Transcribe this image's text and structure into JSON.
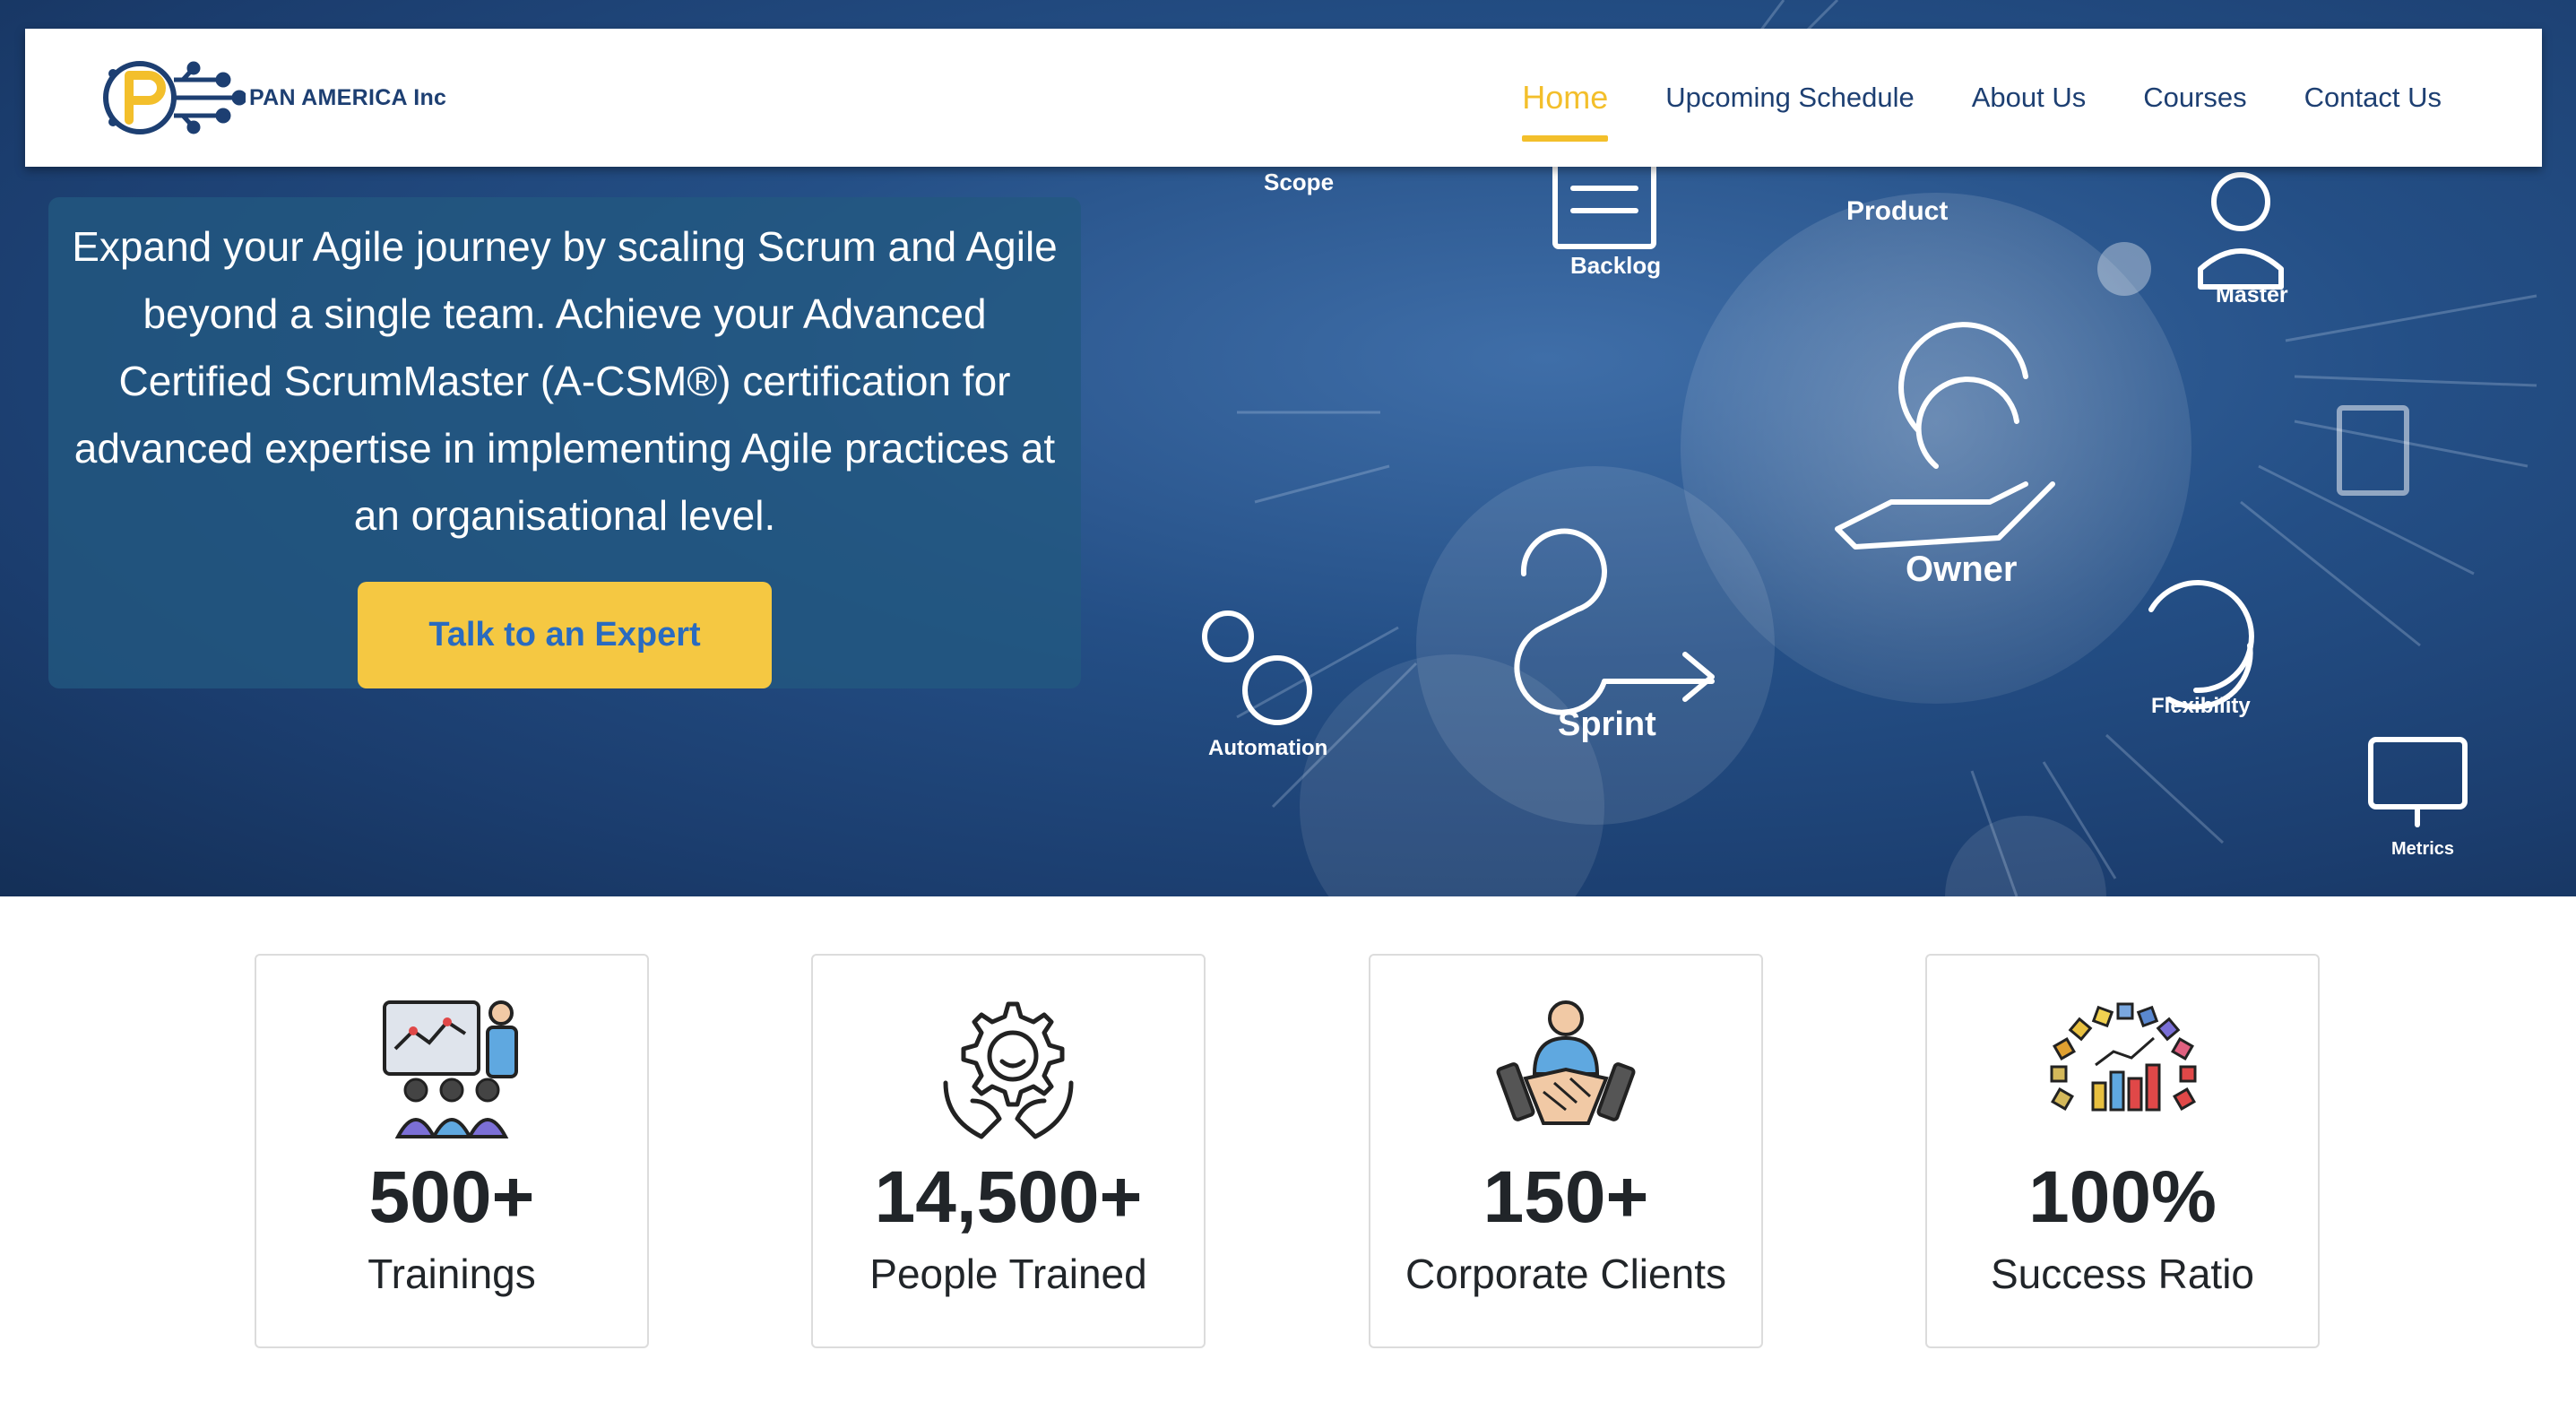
{
  "brand": {
    "name": "PAN AMERICA Inc"
  },
  "nav": {
    "items": [
      {
        "label": "Home",
        "active": true
      },
      {
        "label": "Upcoming Schedule",
        "active": false
      },
      {
        "label": "About Us",
        "active": false
      },
      {
        "label": "Courses",
        "active": false
      },
      {
        "label": "Contact Us",
        "active": false
      }
    ]
  },
  "hero": {
    "text": "Expand your Agile journey by scaling Scrum and Agile beyond a single team. Achieve your Advanced Certified ScrumMaster (A-CSM®) certification for advanced expertise in implementing Agile practices at an organisational level.",
    "cta_label": "Talk to an Expert",
    "art_labels": {
      "scope": "Scope",
      "backlog": "Backlog",
      "product": "Product",
      "master": "Master",
      "owner": "Owner",
      "sprint": "Sprint",
      "automation": "Automation",
      "flexibility": "Flexibility",
      "metrics": "Metrics"
    }
  },
  "stats": [
    {
      "value": "500+",
      "label": "Trainings",
      "icon": "training-presentation-icon"
    },
    {
      "value": "14,500+",
      "label": "People Trained",
      "icon": "person-gear-hands-icon"
    },
    {
      "value": "150+",
      "label": "Corporate Clients",
      "icon": "handshake-icon"
    },
    {
      "value": "100%",
      "label": "Success Ratio",
      "icon": "gauge-chart-icon"
    }
  ],
  "colors": {
    "accent": "#f3bf2b",
    "brand_blue": "#1d3f72",
    "cta_text": "#2a6bbf",
    "hero_bg": "#244f86"
  }
}
